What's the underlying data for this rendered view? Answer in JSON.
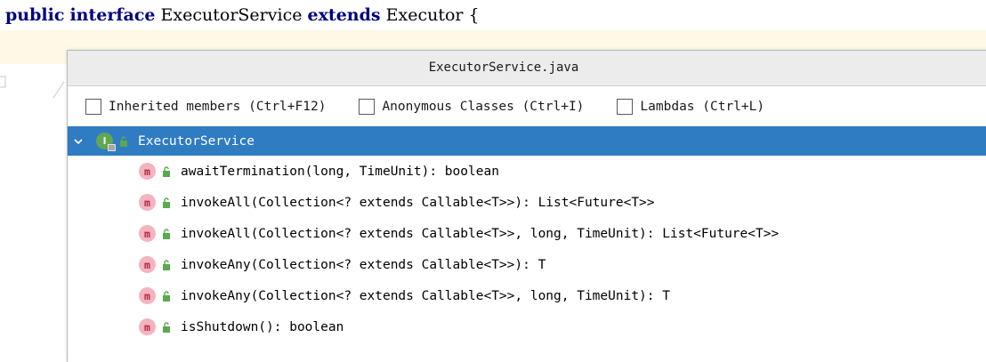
{
  "editor": {
    "code_keyword_public": "public",
    "code_keyword_interface": "interface",
    "code_name": "ExecutorService",
    "code_keyword_extends": "extends",
    "code_parent": "Executor",
    "code_brace": "{"
  },
  "popup": {
    "title": "ExecutorService.java",
    "filters": [
      {
        "label": "Inherited members (Ctrl+F12)",
        "checked": false
      },
      {
        "label": "Anonymous Classes (Ctrl+I)",
        "checked": false
      },
      {
        "label": "Lambdas (Ctrl+L)",
        "checked": false
      }
    ],
    "root": {
      "label": "ExecutorService",
      "icon": "interface-icon",
      "icon_letter": "I",
      "selected": true,
      "expanded": true
    },
    "methods": [
      {
        "label": "awaitTermination(long, TimeUnit): boolean"
      },
      {
        "label": "invokeAll(Collection<? extends Callable<T>>): List<Future<T>>"
      },
      {
        "label": "invokeAll(Collection<? extends Callable<T>>, long, TimeUnit): List<Future<T>>"
      },
      {
        "label": "invokeAny(Collection<? extends Callable<T>>): T"
      },
      {
        "label": "invokeAny(Collection<? extends Callable<T>>, long, TimeUnit): T"
      },
      {
        "label": "isShutdown(): boolean"
      }
    ],
    "method_icon_letter": "m"
  },
  "colors": {
    "selection": "#2f7cc3",
    "keyword": "#000080",
    "interface_icon": "#61a653",
    "method_icon": "#f3b4bf",
    "access_public": "#5aa84f"
  }
}
